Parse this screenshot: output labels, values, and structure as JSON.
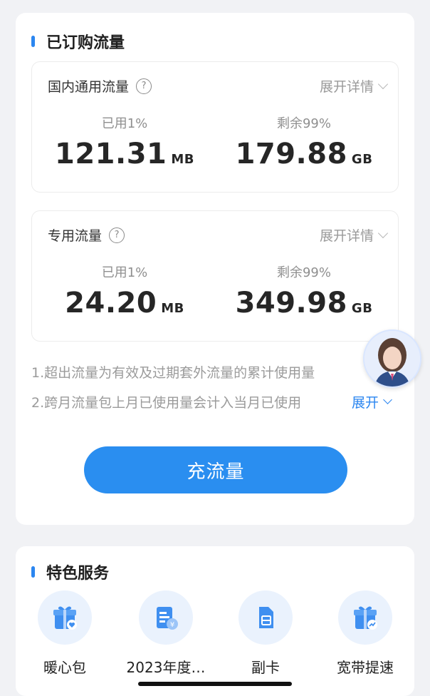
{
  "subscribed": {
    "title": "已订购流量",
    "domestic": {
      "title": "国内通用流量",
      "expand_label": "展开详情",
      "used_caption": "已用1%",
      "used_value": "121.31",
      "used_unit": "MB",
      "remaining_caption": "剩余99%",
      "remaining_value": "179.88",
      "remaining_unit": "GB"
    },
    "dedicated": {
      "title": "专用流量",
      "expand_label": "展开详情",
      "used_caption": "已用1%",
      "used_value": "24.20",
      "used_unit": "MB",
      "remaining_caption": "剩余99%",
      "remaining_value": "349.98",
      "remaining_unit": "GB"
    },
    "notes": [
      "1.超出流量为有效及过期套外流量的累计使用量",
      "2.跨月流量包上月已使用量会计入当月已使用"
    ],
    "expand_more": "展开",
    "recharge_button": "充流量"
  },
  "services": {
    "title": "特色服务",
    "items": [
      {
        "label": "暖心包",
        "icon": "gift-heart-icon"
      },
      {
        "label": "2023年度…",
        "icon": "annual-report-icon"
      },
      {
        "label": "副卡",
        "icon": "sim-card-icon"
      },
      {
        "label": "宽带提速",
        "icon": "gift-speed-icon"
      }
    ]
  },
  "colors": {
    "accent": "#2a8ef0",
    "background": "#f1f2f5"
  }
}
